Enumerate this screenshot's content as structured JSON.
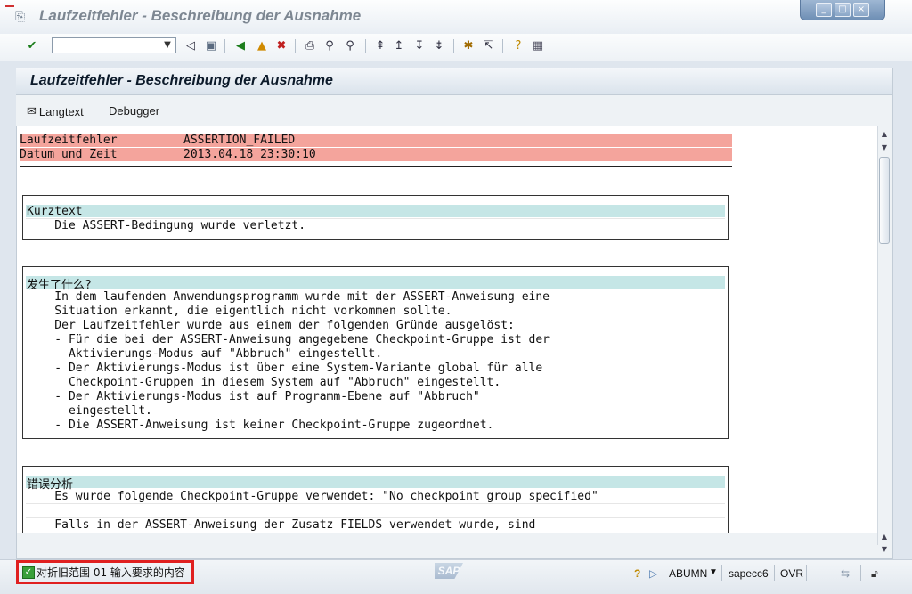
{
  "window": {
    "title": "Laufzeitfehler - Beschreibung der Ausnahme",
    "controls": [
      "_",
      "□",
      "×"
    ]
  },
  "toolbar": {
    "command_value": "",
    "icons": [
      "enter-icon",
      "back-icon",
      "save-icon",
      "back-green-icon",
      "exit-icon",
      "cancel-icon",
      "print-icon",
      "find-icon",
      "find-next-icon",
      "first-page-icon",
      "prev-page-icon",
      "next-page-icon",
      "last-page-icon",
      "new-session-icon",
      "shortcut-icon",
      "help-icon",
      "layout-icon"
    ]
  },
  "screen": {
    "title": "Laufzeitfehler - Beschreibung der Ausnahme",
    "buttons": {
      "langtext": "Langtext",
      "debugger": "Debugger"
    }
  },
  "header_rows": [
    {
      "label": "Laufzeitfehler",
      "value": "ASSERTION_FAILED"
    },
    {
      "label": "Datum und Zeit",
      "value": "2013.04.18 23:30:10"
    }
  ],
  "sections": [
    {
      "heading": "Kurztext",
      "lines": [
        "    Die ASSERT-Bedingung wurde verletzt."
      ]
    },
    {
      "heading": "发生了什么?",
      "lines": [
        "    In dem laufenden Anwendungsprogramm wurde mit der ASSERT-Anweisung eine",
        "    Situation erkannt, die eigentlich nicht vorkommen sollte.",
        "    Der Laufzeitfehler wurde aus einem der folgenden Gründe ausgelöst:",
        "    - Für die bei der ASSERT-Anweisung angegebene Checkpoint-Gruppe ist der",
        "      Aktivierungs-Modus auf \"Abbruch\" eingestellt.",
        "    - Der Aktivierungs-Modus ist über eine System-Variante global für alle",
        "      Checkpoint-Gruppen in diesem System auf \"Abbruch\" eingestellt.",
        "    - Der Aktivierungs-Modus ist auf Programm-Ebene auf \"Abbruch\"",
        "      eingestellt.",
        "    - Die ASSERT-Anweisung ist keiner Checkpoint-Gruppe zugeordnet."
      ]
    },
    {
      "heading": "错误分析",
      "lines": [
        "    Es wurde folgende Checkpoint-Gruppe verwendet: \"No checkpoint group specified\"",
        "",
        "    Falls in der ASSERT-Anweisung der Zusatz FIELDS verwendet wurde, sind"
      ]
    }
  ],
  "statusbar": {
    "message": "对折旧范围 01 输入要求的内容",
    "logo": "SAP",
    "user": "ABUMN",
    "system": "sapecc6",
    "mode": "OVR"
  }
}
